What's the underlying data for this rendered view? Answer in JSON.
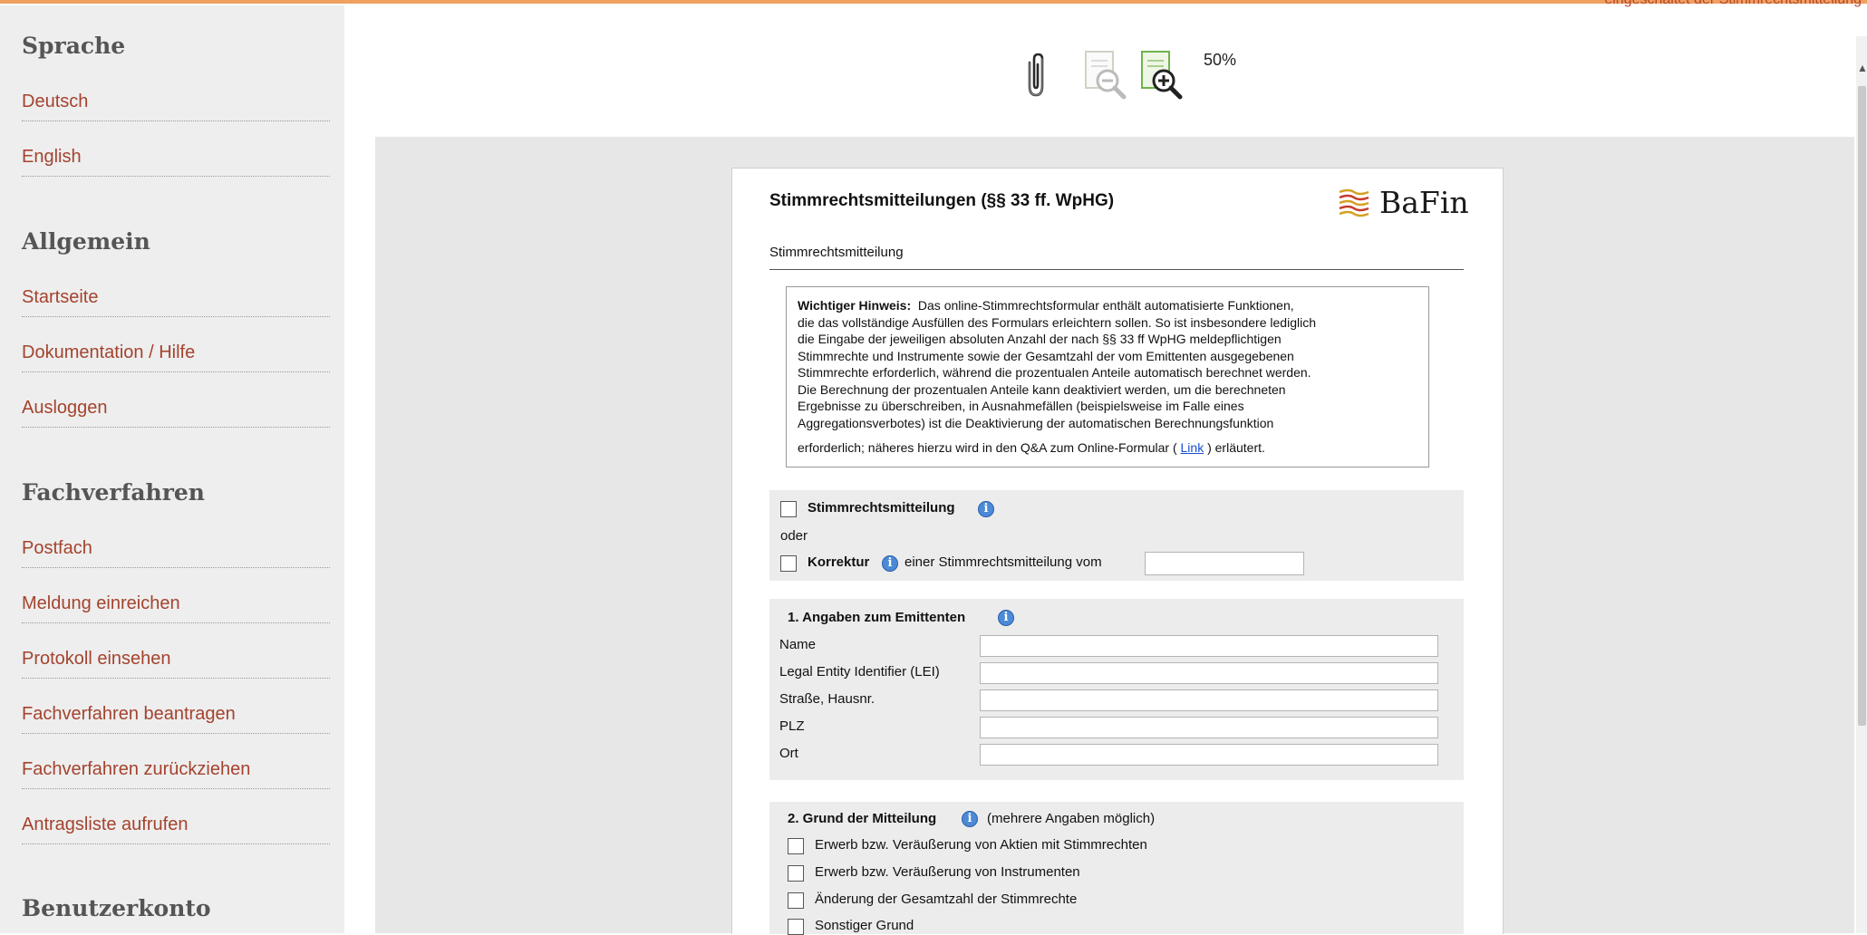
{
  "top_link": "eingeschaltet der Stimmrechtsmitteilung",
  "sidebar": {
    "sprache": {
      "heading": "Sprache",
      "items": [
        "Deutsch",
        "English"
      ]
    },
    "allgemein": {
      "heading": "Allgemein",
      "items": [
        "Startseite",
        "Dokumentation / Hilfe",
        "Ausloggen"
      ]
    },
    "fachverfahren": {
      "heading": "Fachverfahren",
      "items": [
        "Postfach",
        "Meldung einreichen",
        "Protokoll einsehen",
        "Fachverfahren beantragen",
        "Fachverfahren zurückziehen",
        "Antragsliste aufrufen"
      ]
    },
    "benutzerkonto": {
      "heading": "Benutzerkonto"
    }
  },
  "toolbar": {
    "zoom": "50%",
    "icons": [
      "attachment-icon",
      "zoom-out-icon",
      "zoom-in-icon"
    ]
  },
  "form": {
    "title": "Stimmrechtsmitteilungen (§§ 33 ff. WpHG)",
    "logo_text": "BaFin",
    "subtitle": "Stimmrechtsmitteilung",
    "notice": {
      "bold": "Wichtiger Hinweis:",
      "lines": [
        "Das online-Stimmrechtsformular enthält automatisierte Funktionen,",
        "die das vollständige Ausfüllen des Formulars erleichtern sollen. So ist insbesondere lediglich",
        "die Eingabe der jeweiligen absoluten Anzahl der nach §§ 33 ff WpHG meldepflichtigen",
        "Stimmrechte und Instrumente sowie der Gesamtzahl der vom Emittenten ausgegebenen",
        "Stimmrechte erforderlich, während die prozentualen Anteile automatisch berechnet werden.",
        "Die Berechnung der prozentualen Anteile kann deaktiviert werden, um die berechneten",
        "Ergebnisse zu überschreiben, in Ausnahmefällen (beispielsweise im Falle eines",
        "Aggregationsverbotes) ist die Deaktivierung der automatischen Berechnungsfunktion"
      ],
      "last_before": "erforderlich; näheres hierzu wird in den Q&A zum Online-Formular (",
      "link": "Link",
      "last_after": ") erläutert."
    },
    "type": {
      "stimm_label": "Stimmrechtsmitteilung",
      "oder": "oder",
      "korrektur_label": "Korrektur",
      "korrektur_rest": "einer Stimmrechtsmitteilung vom",
      "korrektur_date": ""
    },
    "section1": {
      "heading": "1. Angaben zum Emittenten",
      "fields": [
        {
          "label": "Name",
          "value": ""
        },
        {
          "label": "Legal Entity Identifier (LEI)",
          "value": ""
        },
        {
          "label": "Straße, Hausnr.",
          "value": ""
        },
        {
          "label": "PLZ",
          "value": ""
        },
        {
          "label": "Ort",
          "value": ""
        }
      ]
    },
    "section2": {
      "heading": "2. Grund der Mitteilung",
      "note": "(mehrere Angaben möglich)",
      "options": [
        "Erwerb bzw. Veräußerung von Aktien mit Stimmrechten",
        "Erwerb bzw. Veräußerung von Instrumenten",
        "Änderung der Gesamtzahl der Stimmrechte",
        "Sonstiger Grund"
      ]
    }
  }
}
